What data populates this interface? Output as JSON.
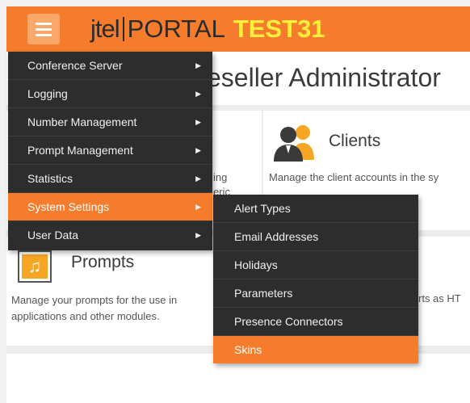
{
  "header": {
    "brand_jtel": "jtel",
    "brand_portal": "PORTAL",
    "brand_env": "TEST31",
    "menu_icon": "hamburger-icon"
  },
  "page": {
    "title_visible": "eseller Administrator"
  },
  "panels": {
    "clients": {
      "icon": "users-icon",
      "title": "Clients",
      "description": "Manage the client accounts in the sy"
    },
    "left_partial": {
      "line1": "ing",
      "line2": "eric"
    },
    "prompts": {
      "icon": "music-note-icon",
      "title": "Prompts",
      "description": "Manage your prompts for the use in applications and other modules."
    },
    "right_partial": "rts as HT"
  },
  "menu": {
    "items": [
      {
        "label": "Conference Server",
        "active": false
      },
      {
        "label": "Logging",
        "active": false
      },
      {
        "label": "Number Management",
        "active": false
      },
      {
        "label": "Prompt Management",
        "active": false
      },
      {
        "label": "Statistics",
        "active": false
      },
      {
        "label": "System Settings",
        "active": true
      },
      {
        "label": "User Data",
        "active": false
      }
    ],
    "arrow_icon": "caret-right-icon"
  },
  "submenu": {
    "items": [
      {
        "label": "Alert Types",
        "active": false
      },
      {
        "label": "Email Addresses",
        "active": false
      },
      {
        "label": "Holidays",
        "active": false
      },
      {
        "label": "Parameters",
        "active": false
      },
      {
        "label": "Presence Connectors",
        "active": false
      },
      {
        "label": "Skins",
        "active": true
      }
    ]
  },
  "colors": {
    "accent": "#f47c2c",
    "menu_bg": "#2d2d2d",
    "env_text": "#ffef3b"
  }
}
